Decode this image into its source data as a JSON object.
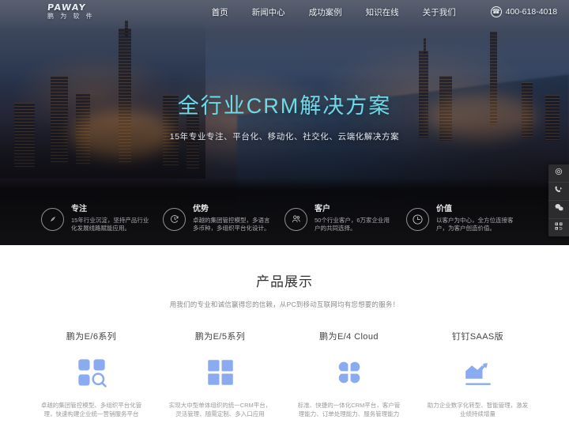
{
  "header": {
    "logo_mark": "PAWAY",
    "logo_sub": "鹏 为 软 件",
    "nav": [
      {
        "label": "首页",
        "active": true
      },
      {
        "label": "新闻中心",
        "active": false
      },
      {
        "label": "成功案例",
        "active": false
      },
      {
        "label": "知识在线",
        "active": false
      },
      {
        "label": "关于我们",
        "active": false
      }
    ],
    "phone_icon": "phone-icon",
    "phone": "400-618-4018"
  },
  "hero": {
    "title": "全行业CRM解决方案",
    "subtitle": "15年专业专注、平台化、移动化、社交化、云端化解决方案",
    "title_color": "#6fd9e8"
  },
  "features": [
    {
      "icon": "compass-icon",
      "title": "专注",
      "desc": "15年行业沉淀，坚持产品行业化发展线路赋能应用。"
    },
    {
      "icon": "clock-arrow-icon",
      "title": "优势",
      "desc": "卓越的集团管控模型，多语言多币种，多组织平台化设计。"
    },
    {
      "icon": "users-icon",
      "title": "客户",
      "desc": "50个行业客户，6万家企业用户的共同选择。"
    },
    {
      "icon": "clock-icon",
      "title": "价值",
      "desc": "以客户为中心，全方位连接客户，为客户创造价值。"
    }
  ],
  "side_widget": [
    {
      "icon": "customer-service-icon",
      "name": "online-service"
    },
    {
      "icon": "phone-callback-icon",
      "name": "phone-callback"
    },
    {
      "icon": "wechat-icon",
      "name": "wechat"
    },
    {
      "icon": "qrcode-icon",
      "name": "qrcode"
    }
  ],
  "products": {
    "title": "产品展示",
    "subtitle": "用我们的专业和诚信赢得您的信赖，从PC到移动互联网均有您想要的服务！",
    "accent_color": "#8aabf0",
    "items": [
      {
        "icon": "grid-search-icon",
        "title": "鹏为E/6系列",
        "desc": "卓越的集团管控模型、多组织平台化管理，快速构建企业统一营销服务平台"
      },
      {
        "icon": "grid-four-icon",
        "title": "鹏为E/5系列",
        "desc": "实现大中型单体组织的统一CRM平台，灵活管理、随需定制、多入口应用"
      },
      {
        "icon": "clover-icon",
        "title": "鹏为E/4 Cloud",
        "desc": "标准、快捷的一体化CRM平台，客户管理能力、订单处理能力、服务管理能力"
      },
      {
        "icon": "chart-growth-icon",
        "title": "钉钉SAAS版",
        "desc": "助力企业数字化转型、智能管理，激发业绩持续增量"
      }
    ]
  }
}
